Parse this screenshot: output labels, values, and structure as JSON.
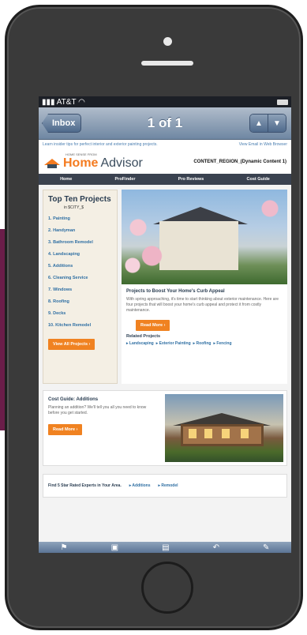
{
  "statusbar": {
    "carrier": "AT&T",
    "signal": "▮▮▮",
    "wifi": "◠"
  },
  "navbar": {
    "inbox_label": "Inbox",
    "title": "1 of 1",
    "up_icon": "▲",
    "down_icon": "▼"
  },
  "email": {
    "preheader_left": "Learn insider tips for perfect interior and exterior painting projects.",
    "preheader_right": "View Email in Web Browser",
    "logo_small": "HOME SENSE FROM",
    "logo_home": "Home",
    "logo_advisor": "Advisor",
    "content_region": "CONTENT_REGION_(Dynamic Content 1)",
    "nav": [
      "Home",
      "ProFinder",
      "Pro Reviews",
      "Cost Guide"
    ],
    "topten": {
      "title": "Top Ten Projects",
      "subtitle": "in $CITY_$",
      "items": [
        "1. Painting",
        "2. Handyman",
        "3. Bathroom Remodel",
        "4. Landscaping",
        "5. Additions",
        "6. Cleaning Service",
        "7. Windows",
        "8. Roofing",
        "9. Decks",
        "10. Kitchen Remodel"
      ],
      "button": "View All Projects ›"
    },
    "feature": {
      "title": "Projects to Boost Your Home's Curb Appeal",
      "body": "With spring approaching, it's time to start thinking about exterior maintenance. Here are four projects that will boost your home's curb appeal and protect it from costly maintenance.",
      "button": "Read More ›"
    },
    "related": {
      "title": "Related Projects",
      "links": [
        "▸ Landscaping",
        "▸ Exterior Painting",
        "▸ Roofing",
        "▸ Fencing"
      ]
    },
    "costguide": {
      "title": "Cost Guide: Additions",
      "body": "Planning an addition? We'll tell you all you need to know before you get started.",
      "button": "Read More ›"
    },
    "experts": {
      "text": "Find 5 Star Rated Experts in Your Area.",
      "link1": "▸ Additions",
      "link2": "▸ Remodel"
    }
  },
  "toolbar": [
    "flag-icon",
    "folder-icon",
    "trash-icon",
    "reply-icon",
    "compose-icon"
  ]
}
